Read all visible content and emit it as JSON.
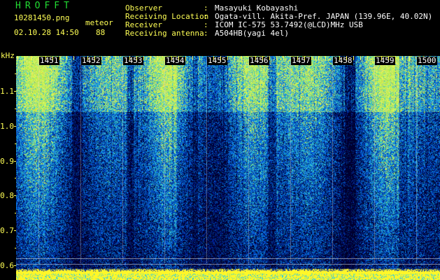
{
  "header": {
    "app_title": "HROFFT",
    "filename": "10281450.png",
    "datetime": "02.10.28 14:50",
    "meteor_label": "meteor",
    "meteor_count": "88"
  },
  "station": [
    {
      "label": "Observer",
      "value": "Masayuki Kobayashi"
    },
    {
      "label": "Receiving Location",
      "value": "Ogata-vill. Akita-Pref. JAPAN (139.96E, 40.02N)"
    },
    {
      "label": "Receiver",
      "value": "ICOM IC-575 53.7492(@LCD)MHz USB"
    },
    {
      "label": "Receiving antenna",
      "value": "A504HB(yagi 4el)"
    }
  ],
  "separator": ":",
  "spectrogram": {
    "y_unit": "kHz",
    "y_ticks": [
      "1.1",
      "1.0",
      "0.9",
      "0.8",
      "0.7",
      "0.6"
    ],
    "y_values": [
      1.1,
      1.0,
      0.9,
      0.8,
      0.7,
      0.6
    ],
    "time_labels": [
      "1451",
      "1452",
      "1453",
      "1454",
      "1455",
      "1456",
      "1457",
      "1458",
      "1459",
      "1500"
    ],
    "colors": {
      "background": "#000000",
      "low": "#0a1a6e",
      "mid": "#2266dd",
      "high": "#22cc88",
      "peak": "#ffff33",
      "text_yellow": "#ffff55",
      "title_green": "#22dd33"
    }
  }
}
